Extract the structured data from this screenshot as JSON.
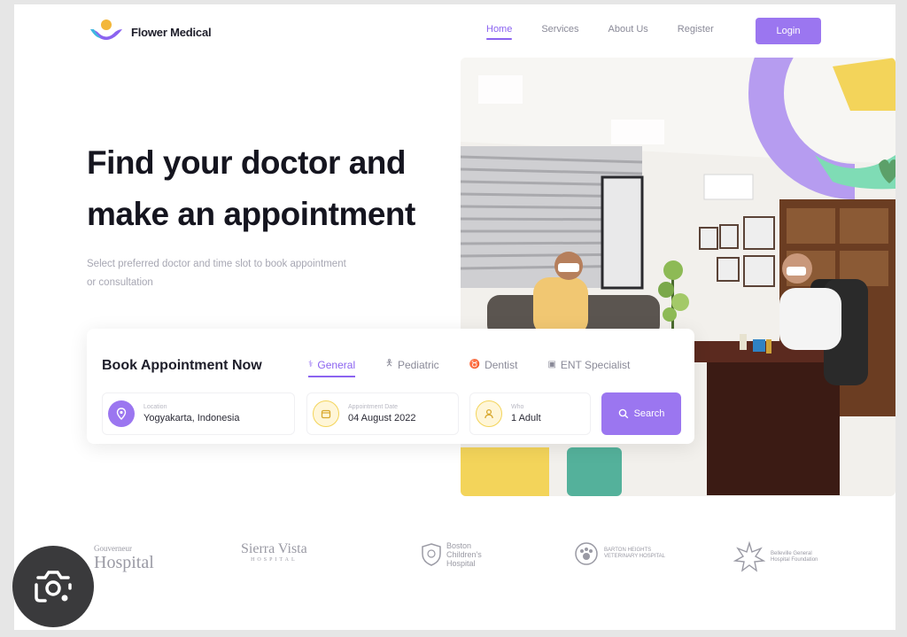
{
  "header": {
    "brand": "Flower Medical",
    "nav": [
      {
        "label": "Home",
        "active": true
      },
      {
        "label": "Services",
        "active": false
      },
      {
        "label": "About Us",
        "active": false
      },
      {
        "label": "Register",
        "active": false
      }
    ],
    "login_label": "Login"
  },
  "hero": {
    "title_line1": "Find your doctor and",
    "title_line2": "make an appointment",
    "subtitle": "Select preferred doctor and time slot to book appointment or consultation"
  },
  "booking": {
    "title": "Book Appointment Now",
    "tabs": [
      {
        "label": "General",
        "icon": "stethoscope-icon",
        "active": true
      },
      {
        "label": "Pediatric",
        "icon": "child-icon",
        "active": false
      },
      {
        "label": "Dentist",
        "icon": "tooth-icon",
        "active": false
      },
      {
        "label": "ENT Specialist",
        "icon": "ear-icon",
        "active": false
      }
    ],
    "location": {
      "label": "Location",
      "value": "Yogyakarta, Indonesia",
      "icon": "location-pin-icon"
    },
    "date": {
      "label": "Appointment Date",
      "value": "04 August 2022",
      "icon": "calendar-icon"
    },
    "who": {
      "label": "Who",
      "value": "1 Adult",
      "icon": "user-icon"
    },
    "search_label": "Search"
  },
  "partners": {
    "p1_top": "Gouverneur",
    "p1_main": "Hospital",
    "p2": "Sierra Vista",
    "p2_sub": "HOSPITAL",
    "p3_line1": "Boston",
    "p3_line2": "Children's",
    "p3_line3": "Hospital",
    "p4_line1": "BARTON HEIGHTS",
    "p4_line2": "VETERINARY HOSPITAL",
    "p5_line1": "Belleville General",
    "p5_line2": "Hospital Foundation"
  },
  "colors": {
    "accent": "#9b76f0",
    "yellow": "#f3d45a",
    "mint": "#7fdcb5"
  }
}
